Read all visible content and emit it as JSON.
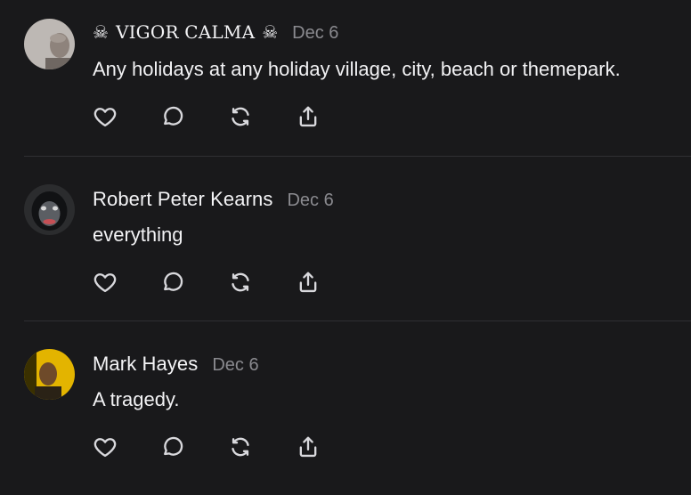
{
  "posts": [
    {
      "author_prefix_icon": "skull-icon",
      "author": "VIGOR CALMA",
      "author_suffix_icon": "skull-icon",
      "date": "Dec 6",
      "text": "Any holidays at any holiday village, city, beach or themepark.",
      "avatar": "gray-portrait-avatar"
    },
    {
      "author": "Robert Peter Kearns",
      "date": "Dec 6",
      "text": "everything",
      "avatar": "chimp-avatar"
    },
    {
      "author": "Mark Hayes",
      "date": "Dec 6",
      "text": "A tragedy.",
      "avatar": "yellow-portrait-avatar"
    }
  ],
  "action_icons": [
    "heart-icon",
    "reply-icon",
    "repost-icon",
    "share-icon"
  ],
  "colors": {
    "background": "#19191b",
    "text": "#f2f2f4",
    "muted": "#8a8a8f",
    "divider": "#2f2f33"
  }
}
